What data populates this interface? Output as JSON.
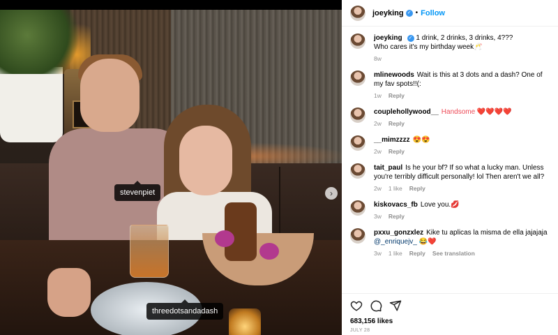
{
  "post": {
    "photo_tags": [
      "stevenpiet",
      "threedotsandadash"
    ]
  },
  "header": {
    "username": "joeyking",
    "follow_label": "Follow"
  },
  "caption": {
    "username": "joeyking",
    "text": "1 drink, 2 drinks, 3 drinks, 4???",
    "text2": "Who cares it's my birthday week🥂",
    "time": "8w"
  },
  "comments": [
    {
      "username": "mlinewoods",
      "text": "Wait is this at 3 dots and a dash? One of my fav spots!!(:",
      "time": "1w",
      "likes": "",
      "reply": "Reply",
      "translation": ""
    },
    {
      "username": "couplehollywood__",
      "text": "Handsome ❤️❤️❤️❤️",
      "time": "2w",
      "likes": "",
      "reply": "Reply",
      "translation": ""
    },
    {
      "username": "__mimzzzz",
      "text": "😍😍",
      "time": "2w",
      "likes": "",
      "reply": "Reply",
      "translation": ""
    },
    {
      "username": "tait_paul",
      "text": "Is he your bf? If so what a lucky man. Unless you're terribly difficult personally! lol Then aren't we all?",
      "time": "2w",
      "likes": "1 like",
      "reply": "Reply",
      "translation": ""
    },
    {
      "username": "kiskovacs_fb",
      "text": "Love you.💋",
      "time": "3w",
      "likes": "",
      "reply": "Reply",
      "translation": ""
    },
    {
      "username": "pxxu_gonzxlez",
      "text": "Kike tu aplicas la misma de ella jajajaja",
      "mention": "@_enriquejv_",
      "emoji": "😂❤️",
      "time": "3w",
      "likes": "1 like",
      "reply": "Reply",
      "translation": "See translation"
    }
  ],
  "footer": {
    "likes": "683,156 likes",
    "date": "JULY 28"
  }
}
